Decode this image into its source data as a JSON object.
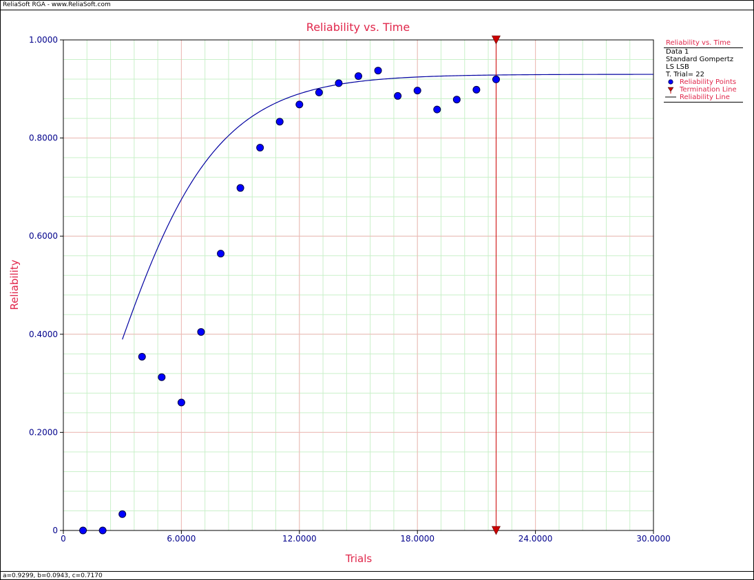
{
  "window": {
    "title": "ReliaSoft RGA - www.ReliaSoft.com",
    "status": "a=0.9299, b=0.0943, c=0.7170"
  },
  "legend": {
    "title": "Reliability vs. Time",
    "lines": [
      "Data 1",
      "Standard Gompertz",
      "LS LSB",
      "T. Trial= 22"
    ],
    "items": [
      {
        "label": "Reliability Points",
        "marker": "point"
      },
      {
        "label": "Termination Line",
        "marker": "triangle"
      },
      {
        "label": "Reliability Line",
        "marker": "line"
      }
    ]
  },
  "colors": {
    "title": "#e0264a",
    "axis_text": "#00008b",
    "points": "#0000ff",
    "curve": "#0000a0",
    "termination": "#cc0000",
    "grid_major": "#f2b6b6",
    "grid_minor": "#c9f0c9"
  },
  "chart_data": {
    "type": "scatter",
    "title": "Reliability vs. Time",
    "xlabel": "Trials",
    "ylabel": "Reliability",
    "xlim": [
      0,
      30
    ],
    "ylim": [
      0,
      1
    ],
    "x_major_ticks": [
      0,
      6,
      12,
      18,
      24,
      30
    ],
    "x_tick_labels": [
      "0",
      "6.0000",
      "12.0000",
      "18.0000",
      "24.0000",
      "30.0000"
    ],
    "x_minor_step": 1.2,
    "y_major_ticks": [
      0,
      0.2,
      0.4,
      0.6,
      0.8,
      1.0
    ],
    "y_tick_labels": [
      "0",
      "0.2000",
      "0.4000",
      "0.6000",
      "0.8000",
      "1.0000"
    ],
    "y_minor_step": 0.04,
    "grid": true,
    "legend_position": "right",
    "series": [
      {
        "name": "Reliability Points",
        "type": "scatter",
        "x": [
          1,
          2,
          3,
          4,
          5,
          6,
          7,
          8,
          9,
          10,
          11,
          12,
          13,
          14,
          15,
          16,
          17,
          18,
          19,
          20,
          21,
          22
        ],
        "y": [
          0.0,
          0.0,
          0.0333,
          0.3542,
          0.3125,
          0.2609,
          0.4047,
          0.5644,
          0.6982,
          0.7803,
          0.8333,
          0.8684,
          0.8929,
          0.9118,
          0.9262,
          0.9375,
          0.8858,
          0.8968,
          0.8582,
          0.8784,
          0.8985,
          0.9195
        ]
      },
      {
        "name": "Reliability Line",
        "type": "line",
        "model": "gompertz",
        "params": {
          "a": 0.9299,
          "b": 0.0943,
          "c": 0.717
        },
        "x_start": 3,
        "x_end": 30
      }
    ],
    "termination_line": {
      "x": 22
    }
  }
}
